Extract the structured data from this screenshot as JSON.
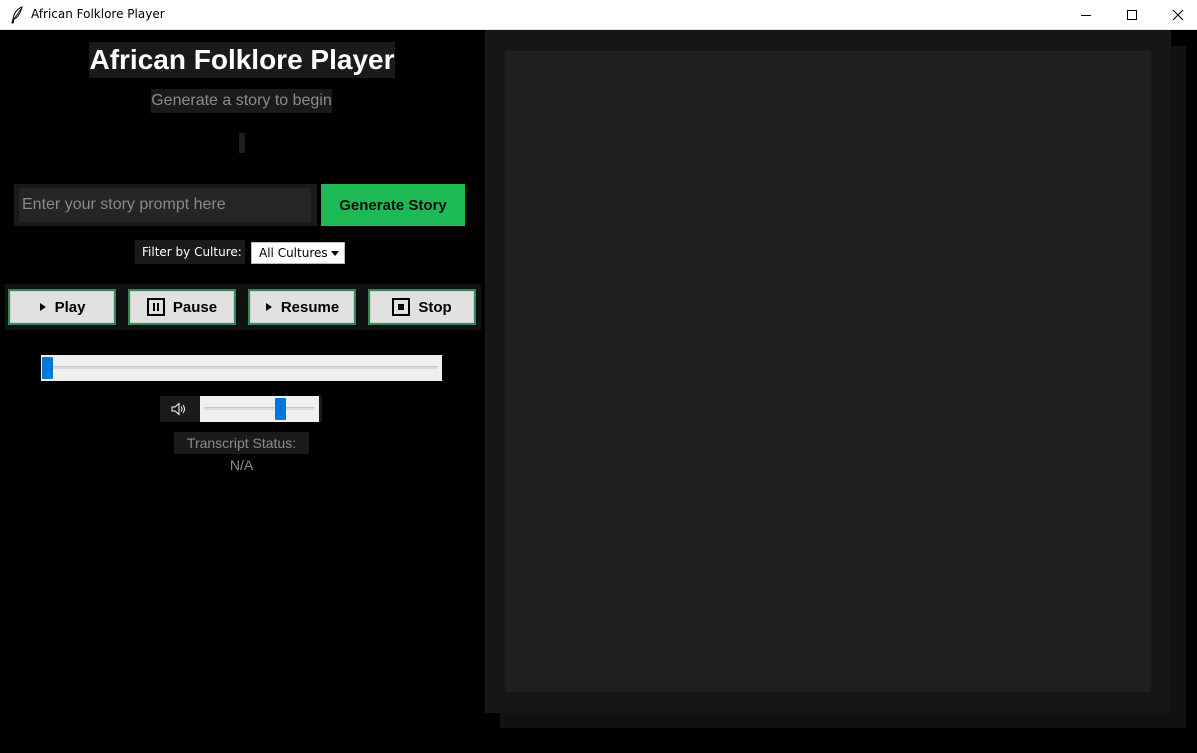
{
  "window": {
    "title": "African Folklore Player",
    "icon": "feather-icon"
  },
  "header": {
    "title": "African Folklore Player",
    "status": "Generate a story to begin"
  },
  "prompt": {
    "placeholder": "Enter your story prompt here",
    "value": "",
    "generate_label": "Generate Story"
  },
  "filter": {
    "label": "Filter by Culture:",
    "selected": "All Cultures"
  },
  "controls": {
    "play_label": "Play",
    "pause_label": "Pause",
    "resume_label": "Resume",
    "stop_label": "Stop"
  },
  "playback": {
    "progress_fraction": 0.0,
    "volume_fraction": 0.7
  },
  "transcript": {
    "status": "Transcript Status: N/A"
  },
  "colors": {
    "accent_green": "#1db954",
    "slider_blue": "#0078d7",
    "background": "#000000",
    "panel": "#202020"
  }
}
